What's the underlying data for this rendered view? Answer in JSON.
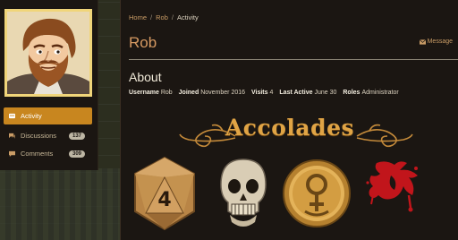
{
  "profile": {
    "name": "Rob"
  },
  "sidebar": {
    "items": [
      {
        "label": "Activity",
        "active": true
      },
      {
        "label": "Discussions",
        "count": "137"
      },
      {
        "label": "Comments",
        "count": "309"
      }
    ]
  },
  "breadcrumb": {
    "home": "Home",
    "user": "Rob",
    "current": "Activity",
    "separator": "/"
  },
  "header": {
    "title": "Rob",
    "message_label": "Message"
  },
  "about": {
    "heading": "About",
    "stats": [
      {
        "key": "Username",
        "value": "Rob"
      },
      {
        "key": "Joined",
        "value": "November 2016"
      },
      {
        "key": "Visits",
        "value": "4"
      },
      {
        "key": "Last Active",
        "value": "June 30"
      },
      {
        "key": "Roles",
        "value": "Administrator"
      }
    ]
  },
  "accolades": {
    "title": "Accolades",
    "badges": [
      {
        "icon": "d20-die-icon",
        "value": "4"
      },
      {
        "icon": "skull-icon"
      },
      {
        "icon": "venus-coin-icon"
      },
      {
        "icon": "blood-splatter-icon"
      }
    ]
  },
  "colors": {
    "accent": "#c8861f",
    "link": "#c99c66",
    "title": "#d69a62",
    "panel": "#1b1612",
    "accolade_gold": "#e0a445"
  }
}
